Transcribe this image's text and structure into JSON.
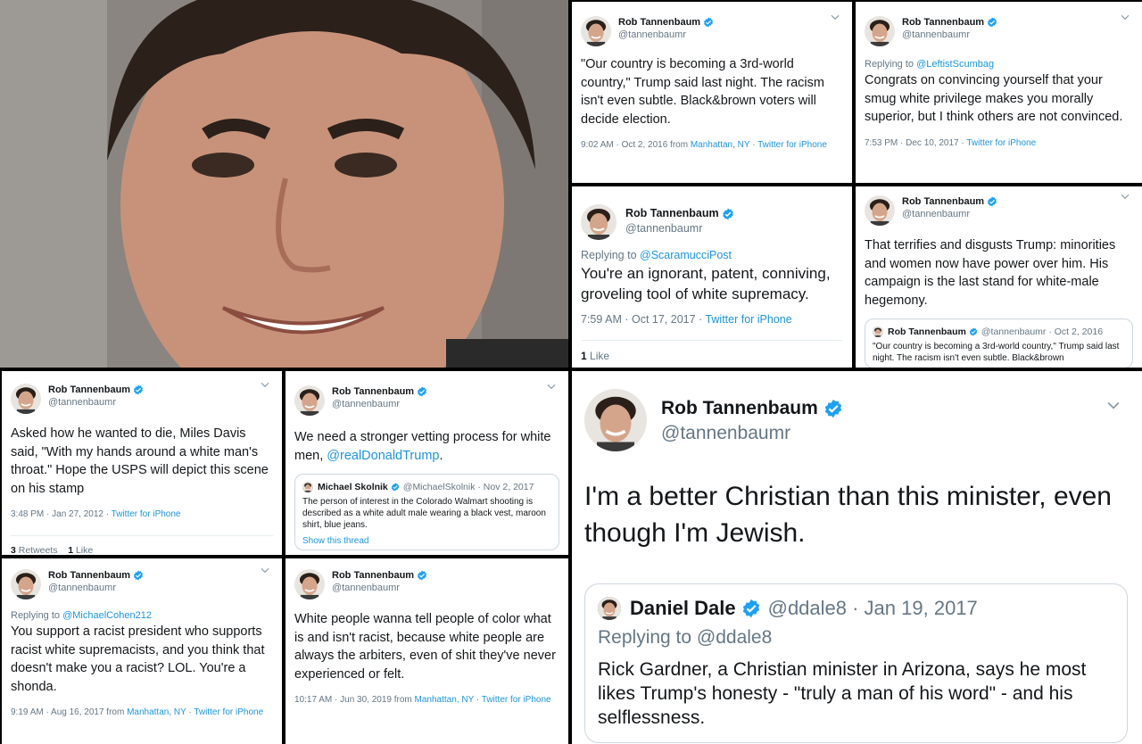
{
  "colors": {
    "link": "#1b95e0",
    "verified": "#1da1f2",
    "muted": "#657786"
  },
  "photo": {
    "alt_icon": "portrait-photo"
  },
  "t1": {
    "name": "Rob Tannenbaum",
    "handle": "@tannenbaumr",
    "body": "\"Our country is becoming a 3rd-world country,\" Trump said last night. The racism isn't even subtle. Black&brown voters will decide election.",
    "time": "9:02 AM · Oct 2, 2016 from ",
    "place": "Manhattan, NY",
    "sep": " · ",
    "source": "Twitter for iPhone"
  },
  "t2": {
    "name": "Rob Tannenbaum",
    "handle": "@tannenbaumr",
    "reply_prefix": "Replying to ",
    "reply_to": "@LeftistScumbag",
    "body": "Congrats on convincing yourself that your smug white privilege makes you morally superior, but I think others are not convinced.",
    "time": "7:53 PM · Dec 10, 2017 · ",
    "source": "Twitter for iPhone"
  },
  "t3": {
    "name": "Rob Tannenbaum",
    "handle": "@tannenbaumr",
    "reply_prefix": "Replying to ",
    "reply_to": "@ScaramucciPost",
    "body": "You're an ignorant, patent, conniving, groveling tool of white supremacy.",
    "time": "7:59 AM · Oct 17, 2017 · ",
    "source": "Twitter for iPhone",
    "likes_n": "1",
    "likes_label": " Like"
  },
  "t4": {
    "name": "Rob Tannenbaum",
    "handle": "@tannenbaumr",
    "body": "That terrifies and disgusts Trump: minorities and women now have power over him. His campaign is the last stand for white-male hegemony.",
    "quote_name": "Rob Tannenbaum",
    "quote_handle": "@tannenbaumr · Oct 2, 2016",
    "quote_body": "\"Our country is becoming a 3rd-world country,\" Trump said last night. The racism isn't even subtle. Black&brown"
  },
  "t5": {
    "name": "Rob Tannenbaum",
    "handle": "@tannenbaumr",
    "body": "Asked how he wanted to die, Miles Davis said, \"With my hands around a white man's throat.\" Hope the USPS will depict this scene on his stamp",
    "time": "3:48 PM · Jan 27, 2012 · ",
    "source": "Twitter for iPhone",
    "retweets_n": "3",
    "retweets_label": " Retweets",
    "likes_n": "1",
    "likes_label": " Like"
  },
  "t6": {
    "name": "Rob Tannenbaum",
    "handle": "@tannenbaumr",
    "body": "We need a stronger vetting process for white men, ",
    "mention": "@realDonaldTrump",
    "body_end": ".",
    "quote_name": "Michael Skolnik",
    "quote_handle": "@MichaelSkolnik · Nov 2, 2017",
    "quote_body": "The person of interest in the Colorado Walmart shooting is described as a white adult male wearing a black vest, maroon shirt, blue jeans.",
    "quote_link": "Show this thread"
  },
  "t7": {
    "name": "Rob Tannenbaum",
    "handle": "@tannenbaumr",
    "reply_prefix": "Replying to ",
    "reply_to": "@MichaelCohen212",
    "body": "You support a racist president who supports racist white supremacists, and you think that doesn't make you a racist? LOL. You're a shonda.",
    "time": "9:19 AM · Aug 16, 2017 from ",
    "place": "Manhattan, NY",
    "sep": " · ",
    "source": "Twitter for iPhone"
  },
  "t8": {
    "name": "Rob Tannenbaum",
    "handle": "@tannenbaumr",
    "body": "White people wanna tell people of color what is and isn't racist, because white people are always the arbiters, even of shit they've never experienced or felt.",
    "time": "10:17 AM · Jun 30, 2019 from ",
    "place": "Manhattan, NY",
    "sep": " · ",
    "source": "Twitter for iPhone"
  },
  "t9": {
    "name": "Rob Tannenbaum",
    "handle": "@tannenbaumr",
    "body": "I'm a better Christian than this minister, even though I'm Jewish.",
    "quote_name": "Daniel Dale",
    "quote_handle": "@ddale8 · Jan 19, 2017",
    "quote_reply": "Replying to @ddale8",
    "quote_body": "Rick Gardner, a Christian minister in Arizona, says he most likes Trump's honesty - \"truly a man of his word\" - and his selflessness."
  }
}
